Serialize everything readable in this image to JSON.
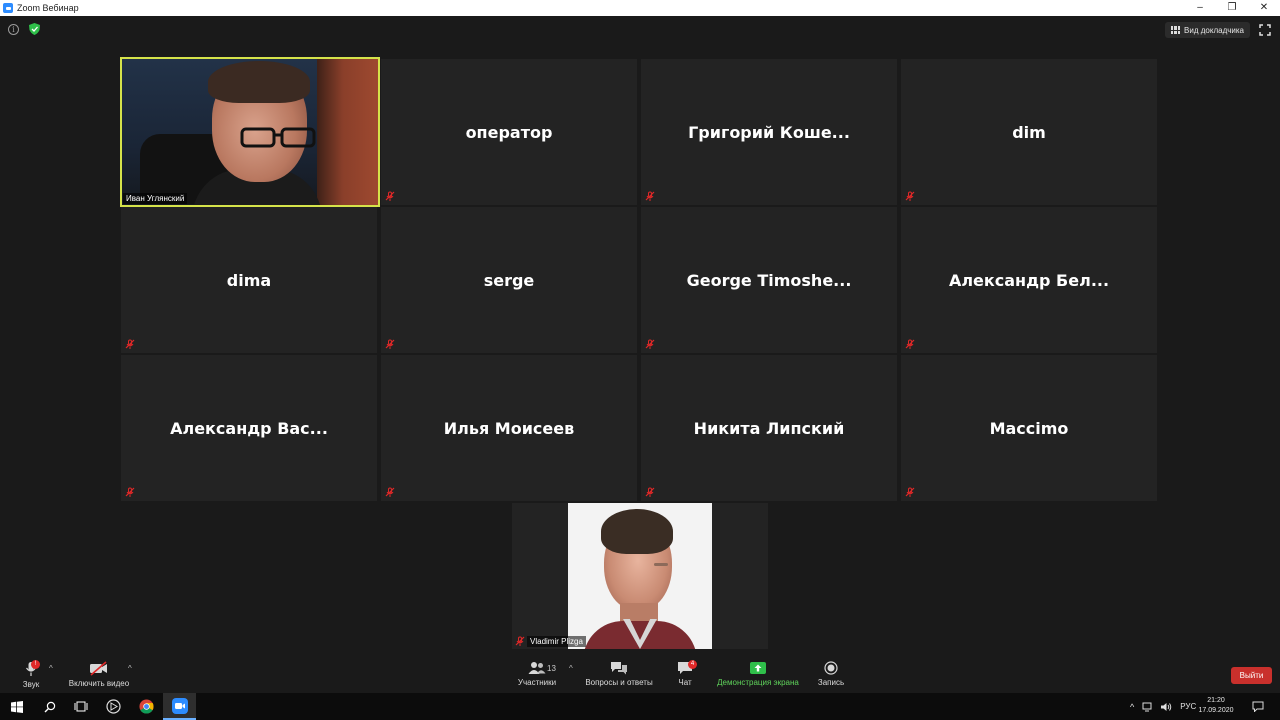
{
  "window": {
    "title": "Zoom Вебинар",
    "controls": {
      "minimize": "–",
      "restore": "❐",
      "close": "✕"
    }
  },
  "topbar": {
    "speaker_view_label": "Вид докладчика",
    "icons": [
      "info-icon",
      "shield-check-icon",
      "speaker-view-icon",
      "fullscreen-icon"
    ]
  },
  "active_video": {
    "name": "Иван Углянский"
  },
  "participants": [
    {
      "name": "оператор"
    },
    {
      "name": "Григорий  Коше..."
    },
    {
      "name": "dim"
    },
    {
      "name": "dima"
    },
    {
      "name": "serge"
    },
    {
      "name": "George  Timoshe..."
    },
    {
      "name": "Александр  Бел..."
    },
    {
      "name": "Александр  Вас..."
    },
    {
      "name": "Илья Моисеев"
    },
    {
      "name": "Никита Липский"
    },
    {
      "name": "Maccimo"
    }
  ],
  "presenter": {
    "name": "Vladimir Plizga"
  },
  "toolbar": {
    "audio_label": "Звук",
    "audio_badge": "!",
    "video_label": "Включить видео",
    "participants_label": "Участники",
    "participants_count": "13",
    "qa_label": "Вопросы и ответы",
    "chat_label": "Чат",
    "chat_badge": "4",
    "share_label": "Демонстрация экрана",
    "record_label": "Запись",
    "leave_label": "Выйти"
  },
  "taskbar": {
    "language": "РУС",
    "time": "21:20",
    "date": "17.09.2020",
    "apps": [
      "windows-start-icon",
      "search-icon",
      "task-view-icon",
      "media-player-icon",
      "chrome-icon",
      "zoom-icon"
    ]
  },
  "colors": {
    "active_speaker_border": "#d5e34a",
    "leave": "#c9302c",
    "share_green": "#5fd35b",
    "tile_bg": "#232323",
    "mute_red": "#e02828"
  }
}
